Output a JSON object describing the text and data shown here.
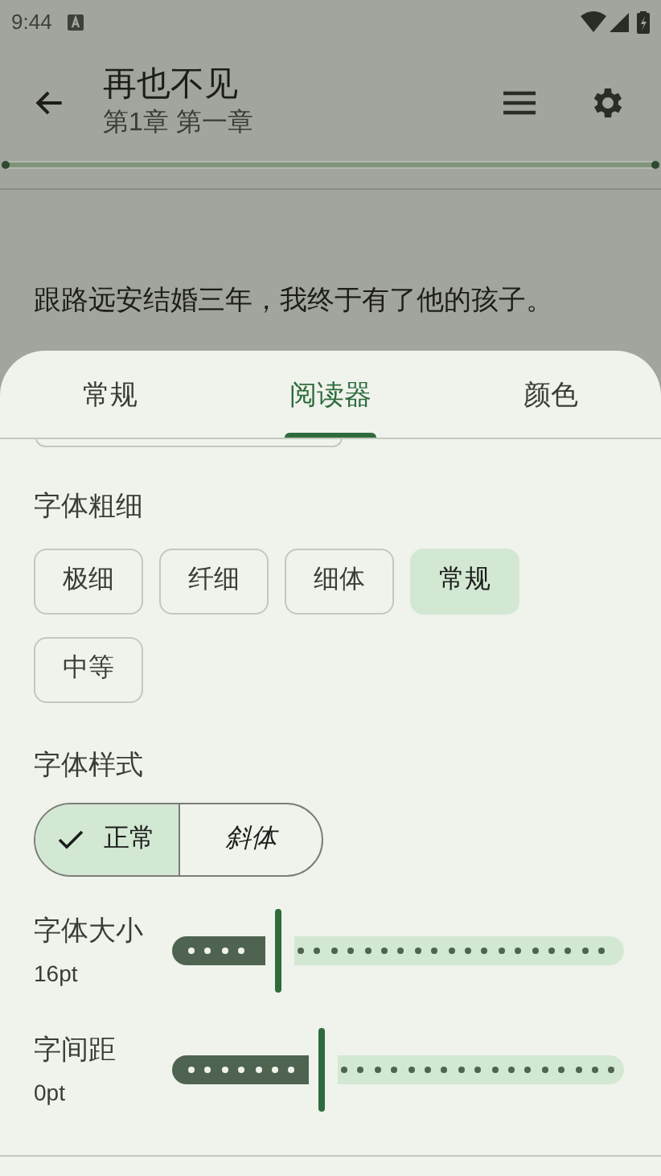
{
  "status_bar": {
    "time": "9:44"
  },
  "app_bar": {
    "title": "再也不见",
    "subtitle": "第1章 第一章"
  },
  "reading_progress": {
    "level": 1
  },
  "content": {
    "text": "跟路远安结婚三年，我终于有了他的孩子。"
  },
  "sheet": {
    "tabs": [
      {
        "label": "常规",
        "selected": false
      },
      {
        "label": "阅读器",
        "selected": true
      },
      {
        "label": "颜色",
        "selected": false
      }
    ],
    "weight": {
      "label": "字体粗细",
      "options": [
        {
          "label": "极细",
          "selected": false
        },
        {
          "label": "纤细",
          "selected": false
        },
        {
          "label": "细体",
          "selected": false
        },
        {
          "label": "常规",
          "selected": true
        },
        {
          "label": "中等",
          "selected": false
        }
      ]
    },
    "style": {
      "label": "字体样式",
      "options": [
        {
          "label": "正常",
          "selected": true,
          "italic": false
        },
        {
          "label": "斜体",
          "selected": false,
          "italic": true
        }
      ]
    },
    "sliders": [
      {
        "label": "字体大小",
        "reading": "16pt",
        "level": 0.235
      },
      {
        "label": "字间距",
        "reading": "0pt",
        "level": 0.33
      }
    ]
  }
}
